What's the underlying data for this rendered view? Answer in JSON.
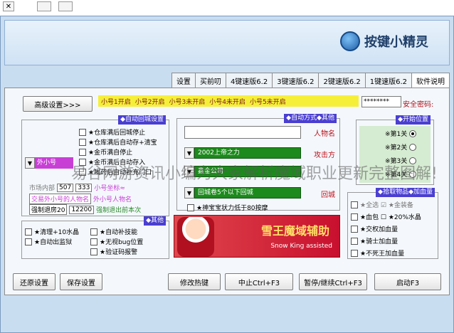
{
  "app": {
    "title": "按键小精灵",
    "brand": "按键小精灵"
  },
  "tabs": [
    {
      "label": "软件说明"
    },
    {
      "label": "1键速版6.2"
    },
    {
      "label": "2键速版6.2"
    },
    {
      "label": "3键速版6.2"
    },
    {
      "label": "4键速版6.2"
    },
    {
      "label": "买前叨"
    },
    {
      "label": "设置"
    }
  ],
  "top": {
    "password_label": "安全密码:",
    "password_value": "********",
    "advanced_button": "高级设置>>>",
    "quick_items": [
      "小号1开启",
      "小号2开启",
      "小号3未开启",
      "小号4未开启",
      "小号5未开启"
    ]
  },
  "start_position": {
    "title": "◆开始位置",
    "options": [
      {
        "label": "※第1关",
        "selected": true
      },
      {
        "label": "※第2关",
        "selected": false
      },
      {
        "label": "※第3关",
        "selected": false
      },
      {
        "label": "※第4关",
        "selected": false
      }
    ]
  },
  "pickup": {
    "title": "◆拾取物品◆加血量",
    "items": [
      {
        "label": "★全选 ☑ ★金装备"
      },
      {
        "label": "★血包  ☐ ★20%水晶"
      },
      {
        "label": "★交权加血量"
      },
      {
        "label": "★骑士加血量"
      },
      {
        "label": "★不死王加血量"
      }
    ]
  },
  "auto_mode": {
    "title": "◆自动方式◆其他",
    "name_label": "人物名",
    "attack_label": "攻击方",
    "attack_value": "2002上帝之力",
    "select1_value": "鑫金公司",
    "return_label": "回城",
    "return_value": "回城卷5个以下回城",
    "auto_resurrect": "★神宝宝状力低于80按摩"
  },
  "auto_recover": {
    "title": "◆自动回城设置",
    "items": [
      {
        "label": "★仓库满后回城停止"
      },
      {
        "label": "★仓库满后自动存+清宝"
      },
      {
        "label": "★金币满自停止"
      },
      {
        "label": "★金币满后自动存入"
      },
      {
        "label": "★喝药后自动补充门口"
      }
    ],
    "number_label": "小号坐标≈",
    "num1": "333",
    "num2": "507",
    "num_suffix": "市场内部",
    "outsider_label": "外小号人物名",
    "outsider_value": "交易外小号的人物名",
    "pay_label": "强制退出前本次",
    "pay_value1": "12200",
    "pay_value2": "强制退房20",
    "dropdown_value": "外小号"
  },
  "other": {
    "title": "◆其他",
    "items": [
      {
        "label": "★自动补技能"
      },
      {
        "label": "★清理+10水晶"
      },
      {
        "label": "★无视bug位置"
      },
      {
        "label": "★自动出监狱"
      },
      {
        "label": "★验证码报警"
      }
    ]
  },
  "banner": {
    "title": "雪王魔域辅助",
    "subtitle": "Snow King assisted"
  },
  "bottom_buttons": {
    "restore": "还原设置",
    "save": "保存设置",
    "change_bind": "修改热键",
    "stop": "中止Ctrl+F3",
    "pause": "暂停/继续Ctrl+F3",
    "start": "启动F3"
  },
  "overlay": {
    "text": "易谷网游资讯小编为大家解析魔域职业更新完整图解!"
  }
}
